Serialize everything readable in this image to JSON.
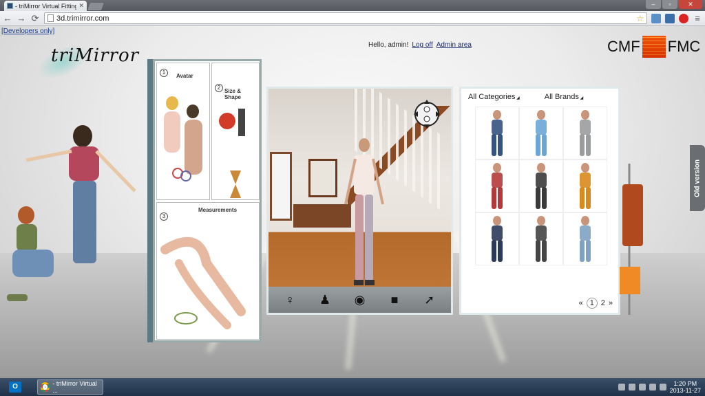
{
  "browser": {
    "tab_title": "- triMirror Virtual Fitting R",
    "url": "3d.trimirror.com"
  },
  "page": {
    "dev_link": "[Developers only]",
    "logo_text": "triMirror",
    "user": {
      "greeting": "Hello, admin!",
      "logoff": "Log off",
      "admin_area": "Admin area"
    },
    "brand": {
      "left": "CMF",
      "right": "FMC"
    },
    "book": {
      "sections": [
        {
          "num": "1",
          "label": "Avatar"
        },
        {
          "num": "2",
          "label": "Size & Shape"
        },
        {
          "num": "3",
          "label": "Measurements"
        }
      ]
    },
    "viewer": {
      "toolbar": [
        {
          "name": "avatar-female-tool",
          "icon": "figure-icon"
        },
        {
          "name": "avatar-dressed-tool",
          "icon": "figure-icon"
        },
        {
          "name": "view-eye-tool",
          "icon": "eye-icon"
        },
        {
          "name": "camera-tool",
          "icon": "camera-icon"
        },
        {
          "name": "arrow-tool",
          "icon": "arrow-icon"
        }
      ]
    },
    "catalog": {
      "category_filter": "All Categories",
      "brand_filter": "All Brands",
      "items": [
        {
          "name": "jeans-dark",
          "color": "#34537f"
        },
        {
          "name": "printed-jeans-blue",
          "color": "#6aa7d6"
        },
        {
          "name": "striped-top",
          "color": "#9b9c9e"
        },
        {
          "name": "red-striped-sweater",
          "color": "#b23a3a"
        },
        {
          "name": "floral-skirt",
          "color": "#3a3a3a"
        },
        {
          "name": "orange-dress",
          "color": "#d88a1c"
        },
        {
          "name": "printed-pants-navy",
          "color": "#2b3a5a"
        },
        {
          "name": "printed-top",
          "color": "#444"
        },
        {
          "name": "light-jeans",
          "color": "#7fa2c2"
        }
      ],
      "pager": {
        "prev": "«",
        "current": "1",
        "next_page": "2",
        "next": "»"
      }
    },
    "side_tab": "Old version"
  },
  "taskbar": {
    "start_label": "O",
    "task_label": "- triMirror Virtual ...",
    "time": "1:20 PM",
    "date": "2013-11-27"
  }
}
